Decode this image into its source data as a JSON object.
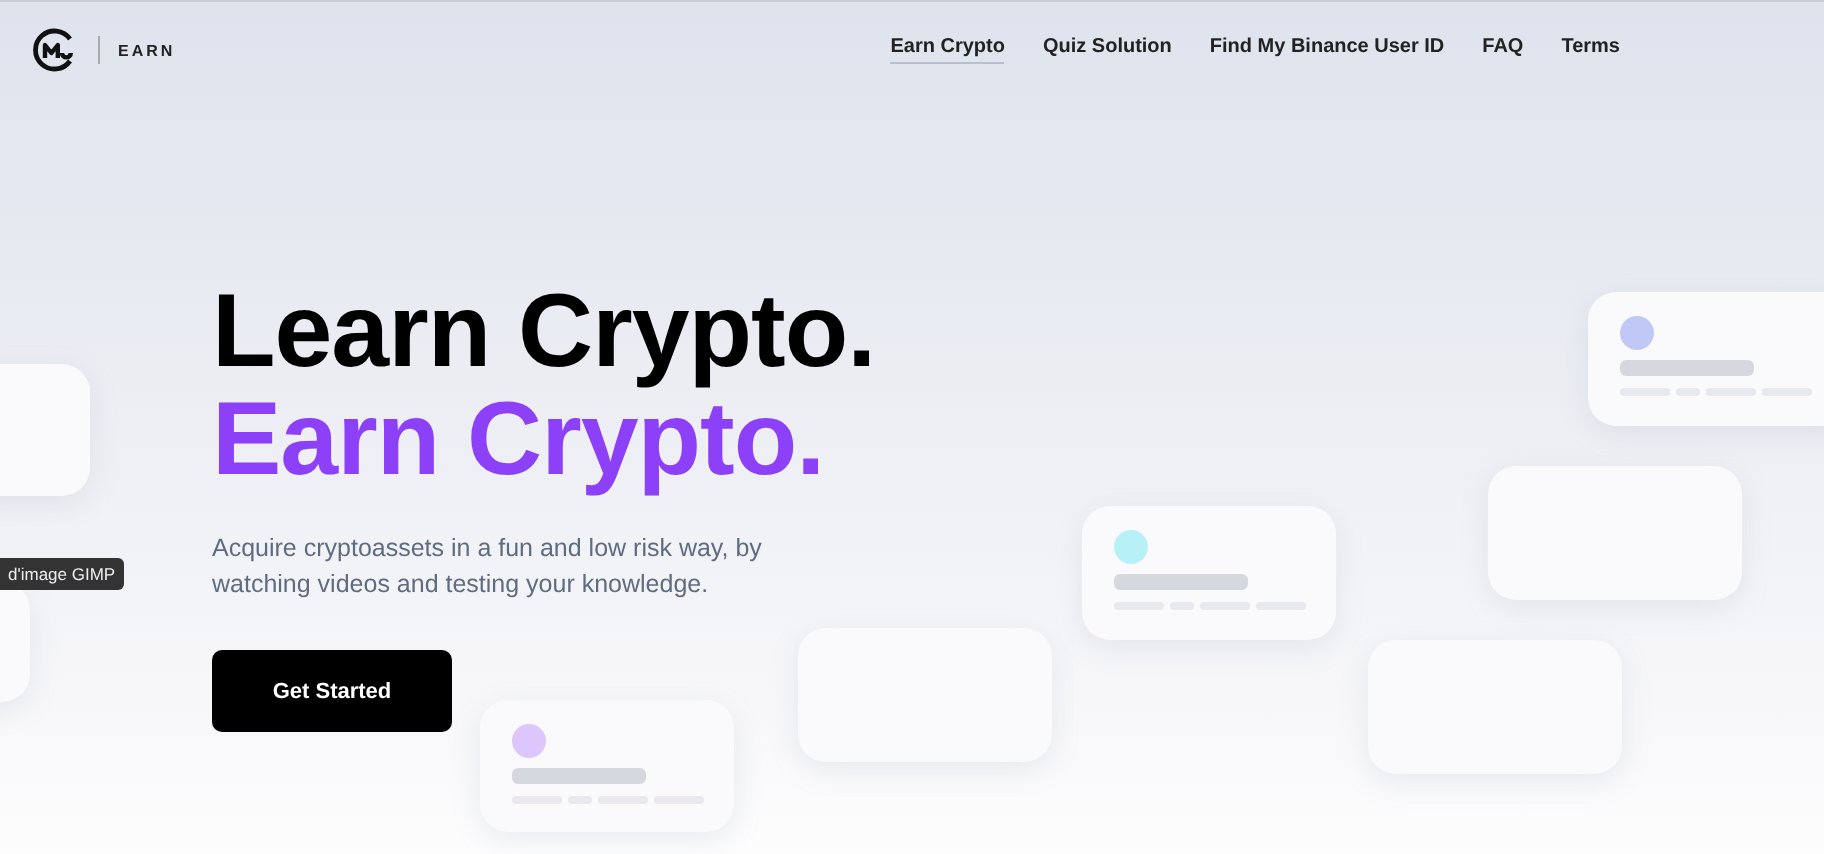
{
  "logo": {
    "label": "EARN"
  },
  "nav": [
    {
      "label": "Earn Crypto",
      "selected": true
    },
    {
      "label": "Quiz Solution",
      "selected": false
    },
    {
      "label": "Find My Binance User ID",
      "selected": false
    },
    {
      "label": "FAQ",
      "selected": false
    },
    {
      "label": "Terms",
      "selected": false
    }
  ],
  "hero": {
    "title_line_1": "Learn Crypto.",
    "title_line_2": "Earn Crypto.",
    "description": "Acquire cryptoassets in a fun and low risk way, by watching videos and testing your knowledge.",
    "button": "Get Started"
  },
  "tooltip": "d'image GIMP"
}
